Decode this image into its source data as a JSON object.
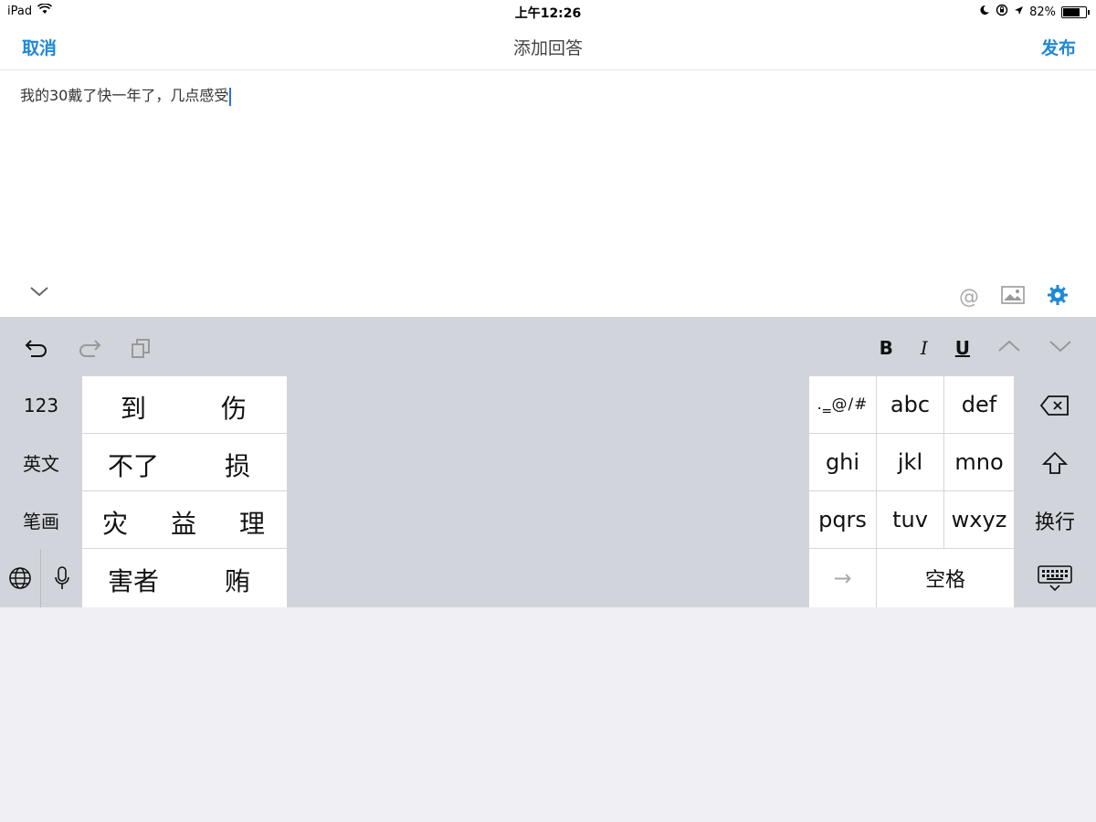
{
  "status_bar": {
    "device": "iPad",
    "time": "上午12:26",
    "battery": "82%",
    "battery_level": 0.82
  },
  "navbar": {
    "cancel_label": "取消",
    "title": "添加回答",
    "publish_label": "发布"
  },
  "editor": {
    "text": "我的30戴了快一年了，几点感受"
  },
  "editor_toolbar": {
    "at_label": "@"
  },
  "format_bar": {
    "bold_label": "B",
    "italic_label": "I",
    "underline_label": "U"
  },
  "keyboard": {
    "left_keys": [
      "123",
      "英文",
      "笔画"
    ],
    "candidates": [
      [
        "到",
        "伤"
      ],
      [
        "不了",
        "损"
      ],
      [
        "灾",
        "益",
        "理"
      ],
      [
        "害者",
        "贿"
      ]
    ],
    "nine_keys": [
      ".‗@/#",
      "abc",
      "def",
      "ghi",
      "jkl",
      "mno",
      "pqrs",
      "tuv",
      "wxyz"
    ],
    "arrow_key": "→",
    "space_label": "空格",
    "return_label": "换行"
  },
  "icons": [
    "wifi-icon",
    "moon-icon",
    "rotation-lock-icon",
    "location-icon",
    "battery-icon",
    "chevron-down-icon",
    "image-icon",
    "gear-icon",
    "undo-icon",
    "redo-icon",
    "paste-icon",
    "chevron-up-icon",
    "delete-icon",
    "shift-icon",
    "globe-icon",
    "mic-icon",
    "keyboard-dismiss-icon"
  ],
  "colors": {
    "accent": "#1e88d8",
    "keyboard_bg": "#d1d5db"
  }
}
